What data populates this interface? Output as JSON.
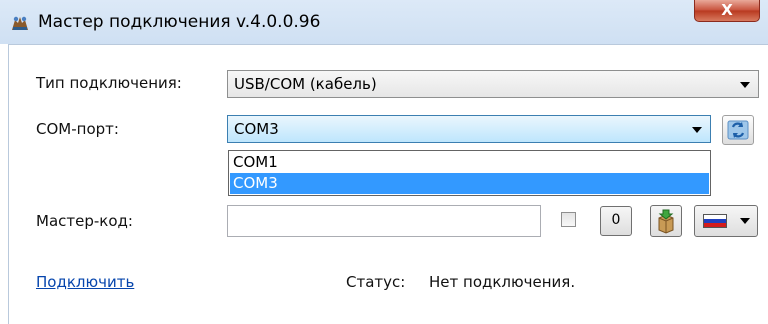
{
  "window": {
    "title": "Мастер подключения v.4.0.0.96",
    "close_label": "X"
  },
  "form": {
    "connection_type_label": "Тип подключения:",
    "connection_type_value": "USB/COM (кабель)",
    "com_port_label": "COM-порт:",
    "com_port_value": "COM3",
    "com_port_options": [
      "COM1",
      "COM3"
    ],
    "master_code_label": "Мастер-код:",
    "master_code_value": "",
    "zero_button_label": "0"
  },
  "footer": {
    "connect_link": "Подключить",
    "status_label": "Статус:",
    "status_value": "Нет подключения."
  },
  "colors": {
    "selection": "#3399ff",
    "link": "#0645ad",
    "focus_border": "#3c7fb1"
  }
}
